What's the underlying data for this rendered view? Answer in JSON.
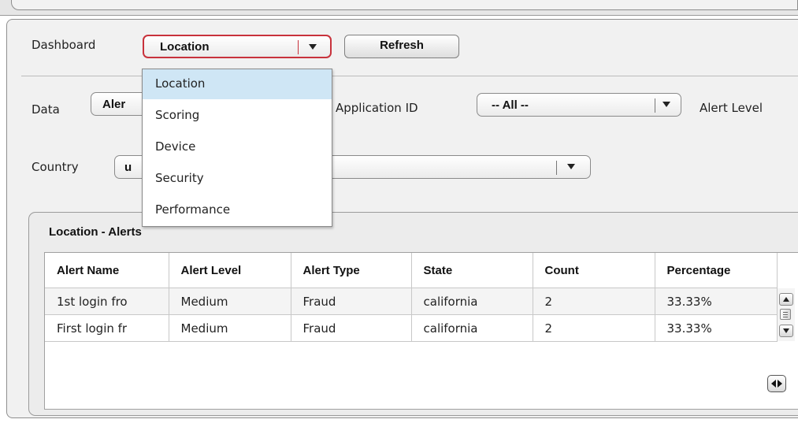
{
  "dashboard": {
    "label": "Dashboard",
    "selected": "Location",
    "refresh_label": "Refresh",
    "options": [
      "Location",
      "Scoring",
      "Device",
      "Security",
      "Performance"
    ]
  },
  "filters": {
    "data_label": "Data",
    "data_value": "Aler",
    "application_id_label": "Application ID",
    "application_id_value": "-- All --",
    "alert_level_label": "Alert Level",
    "country_label": "Country",
    "country_value": "u"
  },
  "grid": {
    "title": "Location - Alerts",
    "columns": [
      "Alert Name",
      "Alert Level",
      "Alert Type",
      "State",
      "Count",
      "Percentage"
    ],
    "rows": [
      [
        "1st login fro",
        "Medium",
        "Fraud",
        "california",
        "2",
        "33.33%"
      ],
      [
        "First login fr",
        "Medium",
        "Fraud",
        "california",
        "2",
        "33.33%"
      ]
    ]
  },
  "colors": {
    "focus_border": "#c8323c",
    "selection_highlight": "#cfe6f5",
    "panel_background": "#f1f1f1"
  },
  "icons": {
    "dropdown": "chevron-down-icon",
    "scroll_up": "scroll-up-icon",
    "scroll_down": "scroll-down-icon",
    "horizontal_scroll": "left-right-icon"
  }
}
